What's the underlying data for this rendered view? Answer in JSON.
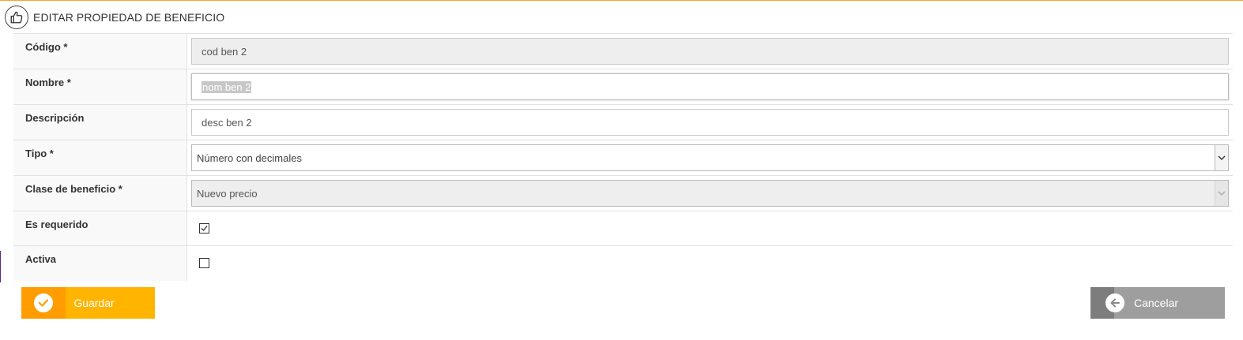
{
  "header": {
    "title": "EDITAR PROPIEDAD DE BENEFICIO",
    "icon": "thumbs-up-icon"
  },
  "form": {
    "codigo": {
      "label": "Código *",
      "value": "cod ben 2"
    },
    "nombre": {
      "label": "Nombre *",
      "value": "nom ben 2"
    },
    "descripcion": {
      "label": "Descripción",
      "value": "desc ben 2"
    },
    "tipo": {
      "label": "Tipo *",
      "value": "Número con decimales"
    },
    "clase": {
      "label": "Clase de beneficio *",
      "value": "Nuevo precio"
    },
    "requerido": {
      "label": "Es requerido",
      "checked": true
    },
    "activa": {
      "label": "Activa",
      "checked": false
    }
  },
  "buttons": {
    "save": {
      "label": "Guardar",
      "icon": "check-circle-icon",
      "color": "#ffb400"
    },
    "cancel": {
      "label": "Cancelar",
      "icon": "arrow-left-circle-icon",
      "color": "#9e9e9e"
    }
  },
  "colors": {
    "accent_line": "#f5a623",
    "disabled_bg": "#eeeeee"
  }
}
